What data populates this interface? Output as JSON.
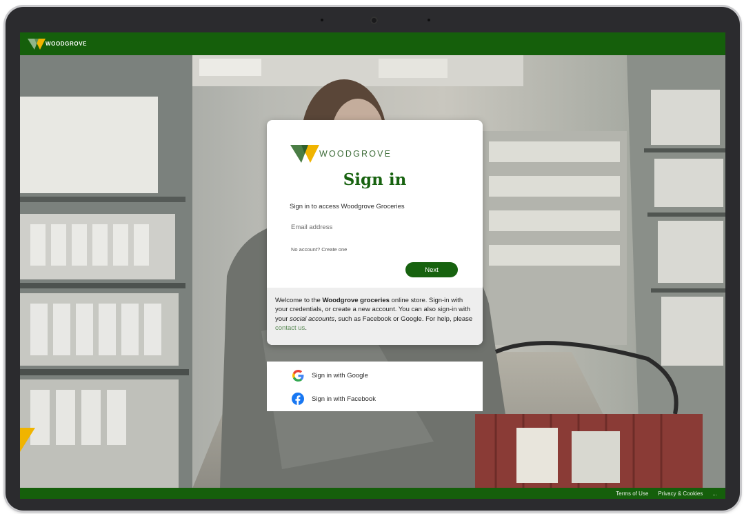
{
  "brand": {
    "name": "WOODGROVE",
    "colors": {
      "primary": "#155f0b",
      "accent": "#f0b400",
      "logo_green": "#4a7d45"
    }
  },
  "card": {
    "title": "Sign in",
    "intro": "Sign in to access Woodgrove Groceries",
    "email_placeholder": "Email address",
    "email_value": "",
    "no_account_prefix": "No account? ",
    "create_link": "Create one",
    "next_label": "Next",
    "welcome": {
      "text1": "Welcome to the ",
      "bold": "Woodgrove groceries",
      "text2": " online store. Sign-in with your credentials, or create a new account. You can also sign-in with your ",
      "italic": "social accounts",
      "text3": ", such as Facebook or Google. For help, please ",
      "link": "contact us",
      "text4": "."
    }
  },
  "social": {
    "google_label": "Sign in with Google",
    "facebook_label": "Sign in with Facebook",
    "icons": [
      "google-icon",
      "facebook-icon"
    ]
  },
  "footer": {
    "terms": "Terms of Use",
    "privacy": "Privacy & Cookies",
    "more": "..."
  }
}
